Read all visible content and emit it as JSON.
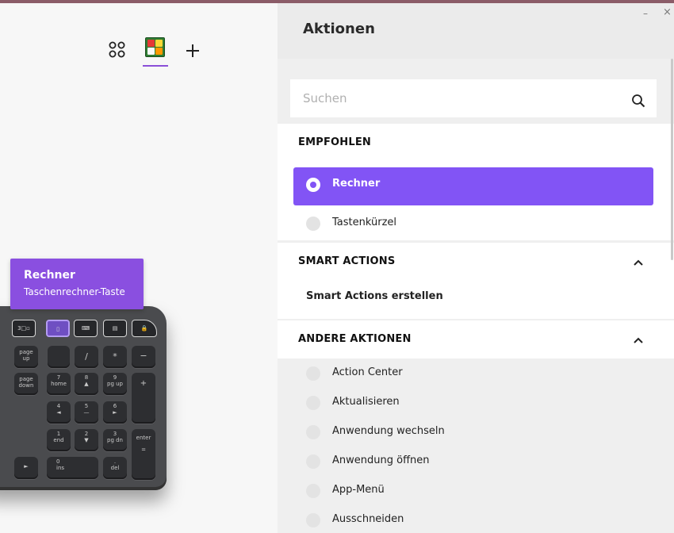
{
  "colors": {
    "accent": "#8254f5",
    "tooltip_bg": "#8a4fe0",
    "panel_bg": "#efefef"
  },
  "toolbar": {
    "apps_icon": "apps-grid-icon",
    "active_app_icon": "calculator-app-icon",
    "add_icon": "plus-icon"
  },
  "tooltip": {
    "title": "Rechner",
    "subtitle": "Taschenrechner-Taste"
  },
  "keyboard": {
    "fkeys": [
      "3□▫",
      "▯",
      "⌨",
      "▤",
      "🔒"
    ],
    "keys": [
      {
        "label": "page\nup"
      },
      {
        "label": "/"
      },
      {
        "label": "*"
      },
      {
        "label": "−"
      },
      {
        "label": "page\ndown"
      },
      {
        "label": "7\nhome"
      },
      {
        "label": "8\n▲"
      },
      {
        "label": "9\npg up"
      },
      {
        "label": "+"
      },
      {
        "label": "4\n◄"
      },
      {
        "label": "5\n—"
      },
      {
        "label": "6\n►"
      },
      {
        "label": "1\nend"
      },
      {
        "label": "2\n▼"
      },
      {
        "label": "3\npg dn"
      },
      {
        "label": "enter\n\n="
      },
      {
        "label": "0\nins"
      },
      {
        "label": ".\ndel"
      },
      {
        "label": "►"
      }
    ]
  },
  "panel": {
    "title": "Aktionen",
    "minimize": "–",
    "close": "×",
    "search": {
      "placeholder": "Suchen",
      "value": ""
    },
    "recommended": {
      "title": "EMPFOHLEN",
      "selected": "Rechner",
      "items": [
        "Tastenkürzel"
      ]
    },
    "smart_actions": {
      "title": "SMART ACTIONS",
      "create_label": "Smart Actions erstellen"
    },
    "other_actions": {
      "title": "ANDERE AKTIONEN",
      "items": [
        "Action Center",
        "Aktualisieren",
        "Anwendung wechseln",
        "Anwendung öffnen",
        "App-Menü",
        "Ausschneiden"
      ]
    }
  }
}
